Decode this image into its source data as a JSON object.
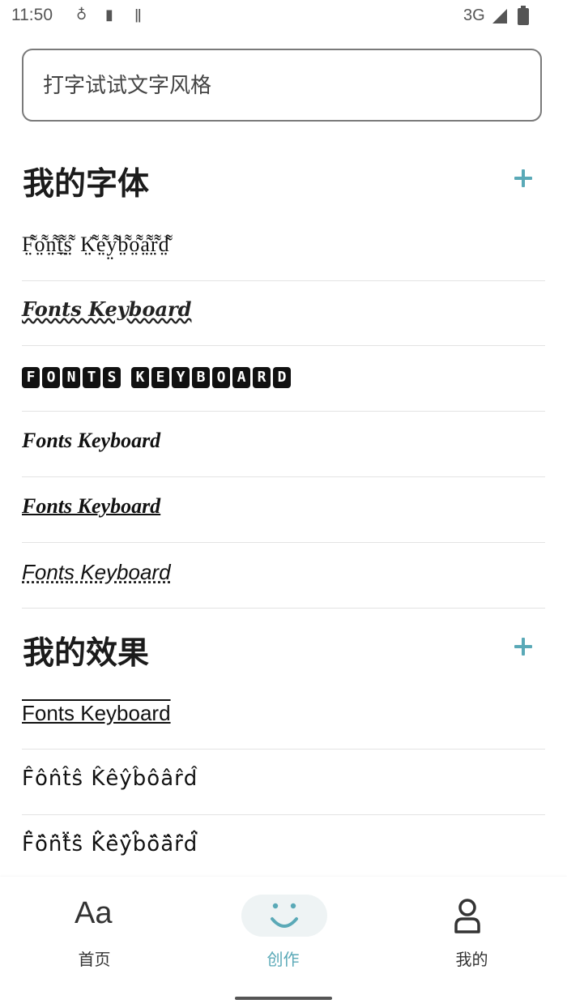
{
  "status_bar": {
    "time": "11:50",
    "network": "3G"
  },
  "search": {
    "placeholder": "打字试试文字风格"
  },
  "my_fonts": {
    "title": "我的字体",
    "items": [
      "F̤͌o̤͌n̤͌ṯ̤͌s̤͌ K̤͌e̤͌y̤͌b̤͌o̤͌a̤͌r̤͌d̤͌",
      "Fonts Keyboard",
      "FONTS KEYBOARD",
      "Fonts Keyboard",
      "Fonts Keyboard",
      "Fonts Keyboard"
    ]
  },
  "my_effects": {
    "title": "我的效果",
    "items": [
      "Fonts Keyboard",
      "F̂ôn̂t̂ŝ K̂êŷb̂ôâr̂d̂",
      "F̈̂ö̂n̈̂ẗ̂s̈̂ K̈̂ë̂ÿ̂b̈̂ö̂ä̂r̈̂d̈̂"
    ]
  },
  "bottom_nav": {
    "items": [
      {
        "label": "首页",
        "icon": "font-aa-icon"
      },
      {
        "label": "创作",
        "icon": "smile-icon",
        "active": true
      },
      {
        "label": "我的",
        "icon": "person-icon"
      }
    ]
  },
  "colors": {
    "accent": "#5aa9b7",
    "text": "#1b1b1b"
  }
}
